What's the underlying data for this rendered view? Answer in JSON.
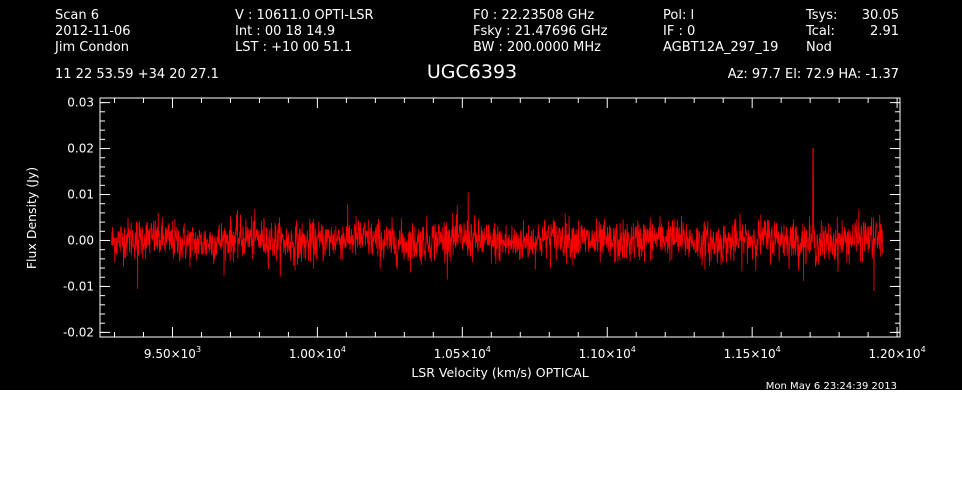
{
  "header": {
    "col1": [
      "Scan        6",
      "2012-11-06",
      "Jim Condon"
    ],
    "col2": [
      "V   :   10611.0 OPTI-LSR",
      "Int  :  00 18 14.9",
      "LST : +10 00 51.1"
    ],
    "col3": [
      "F0   :  22.23508 GHz",
      "Fsky :  21.47696 GHz",
      "BW   : 200.0000 MHz"
    ],
    "col4": [
      "Pol:     l",
      "IF :      0",
      "AGBT12A_297_19"
    ],
    "col5": [
      "Tsys:",
      "Tcal:",
      "Nod"
    ],
    "col5_values": [
      "30.05",
      "2.91",
      ""
    ],
    "coords": "11 22 53.59  +34 20 27.1",
    "pointing": "Az:  97.7  El:  72.9  HA: -1.37",
    "timestamp": "Mon May  6 23:24:39 2013"
  },
  "chart_data": {
    "type": "line",
    "title": "UGC6393",
    "xlabel": "LSR Velocity (km/s) OPTICAL",
    "ylabel": "Flux Density (Jy)",
    "xlim": [
      9250,
      12010
    ],
    "ylim": [
      -0.021,
      0.031
    ],
    "x_ticks": [
      9500,
      10000,
      10500,
      11000,
      11500,
      12000
    ],
    "x_tick_labels": [
      {
        "mant": "9.50×10",
        "exp": "3"
      },
      {
        "mant": "1.00×10",
        "exp": "4"
      },
      {
        "mant": "1.05×10",
        "exp": "4"
      },
      {
        "mant": "1.10×10",
        "exp": "4"
      },
      {
        "mant": "1.15×10",
        "exp": "4"
      },
      {
        "mant": "1.20×10",
        "exp": "4"
      }
    ],
    "y_ticks": [
      -0.02,
      -0.01,
      0.0,
      0.01,
      0.02,
      0.03
    ],
    "y_tick_labels": [
      "-0.02",
      "-0.01",
      "0.00",
      "0.01",
      "0.02",
      "0.03"
    ],
    "grid": false,
    "series": [
      {
        "color": "#ff0000",
        "x_start": 9290,
        "x_end": 11950,
        "noise_rms": 0.0025,
        "spikes": [
          {
            "x": 11710,
            "y": 0.02
          },
          {
            "x": 9380,
            "y": -0.0105
          },
          {
            "x": 11920,
            "y": -0.011
          },
          {
            "x": 10520,
            "y": 0.0105
          }
        ]
      }
    ]
  }
}
